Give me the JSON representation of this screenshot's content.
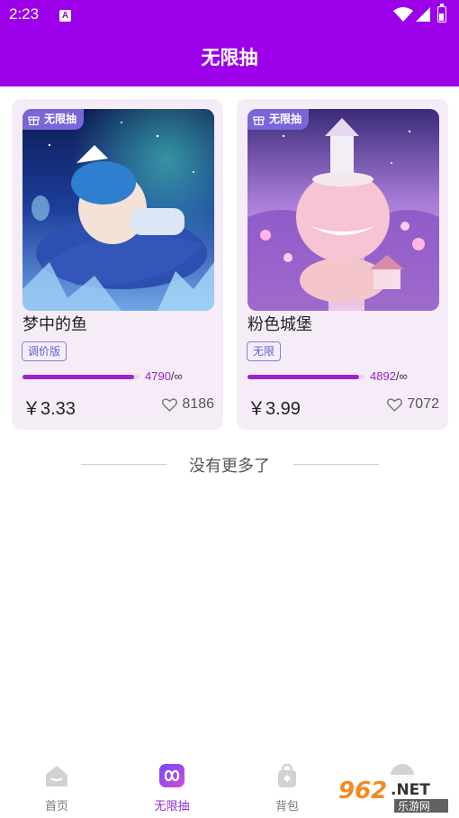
{
  "status_bar": {
    "time": "2:23",
    "notification_icon": "A"
  },
  "header": {
    "title": "无限抽"
  },
  "products": [
    {
      "tag": "无限抽",
      "name": "梦中的鱼",
      "badge": "调价版",
      "progress_fraction": 0.95,
      "count": "4790",
      "count_suffix": "/∞",
      "price": "￥3.33",
      "likes": "8186"
    },
    {
      "tag": "无限抽",
      "name": "粉色城堡",
      "badge": "无限",
      "progress_fraction": 0.95,
      "count": "4892",
      "count_suffix": "/∞",
      "price": "￥3.99",
      "likes": "7072"
    }
  ],
  "footer_note": "没有更多了",
  "tabs": [
    {
      "label": "首页",
      "icon": "home-icon",
      "active": false
    },
    {
      "label": "无限抽",
      "icon": "infinity-icon",
      "active": true
    },
    {
      "label": "背包",
      "icon": "bag-icon",
      "active": false
    },
    {
      "label": "",
      "icon": "profile-icon",
      "active": false
    }
  ],
  "watermark": {
    "text_top": "962.NET",
    "text_bottom": "乐游网"
  },
  "colors": {
    "brand": "#9b00e8",
    "accent": "#9a24c8",
    "tag": "#7a66d9"
  }
}
